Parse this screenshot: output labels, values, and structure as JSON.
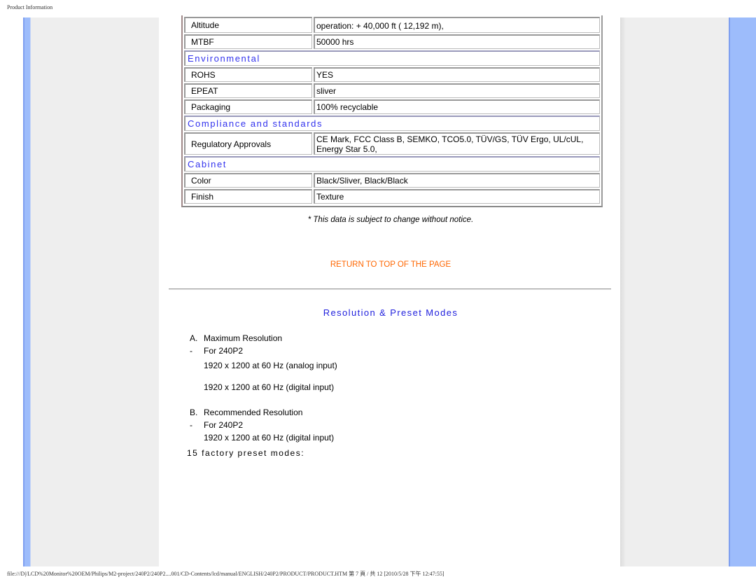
{
  "print_header": "Product Information",
  "print_footer": "file:///D|/LCD%20Monitor%20OEM/Philips/M2-project/240P2/240P2....001/CD-Contents/lcd/manual/ENGLISH/240P2/PRODUCT/PRODUCT.HTM 第 7 頁 / 共 12 [2010/5/28 下午 12:47:55]",
  "colors": {
    "section_heading": "#3333ee",
    "link": "#ff6600",
    "frame_blue": "#9dbcfb",
    "panel_gray": "#eeeeee"
  },
  "spec_table": {
    "rows": [
      {
        "type": "item",
        "label": "Altitude",
        "value": "operation: + 40,000 ft ( 12,192 m),"
      },
      {
        "type": "item",
        "label": "MTBF",
        "value": "50000 hrs"
      },
      {
        "type": "section",
        "title": "Environmental"
      },
      {
        "type": "item",
        "label": "ROHS",
        "value": "YES"
      },
      {
        "type": "item",
        "label": "EPEAT",
        "value": "sliver"
      },
      {
        "type": "item",
        "label": "Packaging",
        "value": "100% recyclable"
      },
      {
        "type": "section",
        "title": "Compliance and standards"
      },
      {
        "type": "item",
        "label": "Regulatory Approvals",
        "value": "CE Mark, FCC Class B, SEMKO, TCO5.0, TÜV/GS, TÜV Ergo, UL/cUL, Energy Star 5.0,"
      },
      {
        "type": "section",
        "title": "Cabinet"
      },
      {
        "type": "item",
        "label": "Color",
        "value": "Black/Sliver, Black/Black"
      },
      {
        "type": "item",
        "label": "Finish",
        "value": "Texture"
      }
    ]
  },
  "notice": "* This data is subject to change without notice.",
  "return_link": "RETURN TO TOP OF THE PAGE",
  "resolution_section": {
    "title": "Resolution & Preset Modes",
    "lines": [
      {
        "mark": "A.",
        "text": "Maximum Resolution"
      },
      {
        "mark": "-",
        "text": "For 240P2"
      },
      {
        "mark": "",
        "text": "1920 x 1200 at 60 Hz (analog input)"
      },
      {
        "mark": "",
        "text": "1920 x 1200 at 60 Hz (digital input)"
      },
      {
        "mark": "B.",
        "text": "Recommended Resolution"
      },
      {
        "mark": "-",
        "text": "For 240P2"
      },
      {
        "mark": "",
        "text": "1920 x 1200 at 60 Hz (digital input)"
      }
    ],
    "preset_modes": "15 factory preset modes:"
  }
}
